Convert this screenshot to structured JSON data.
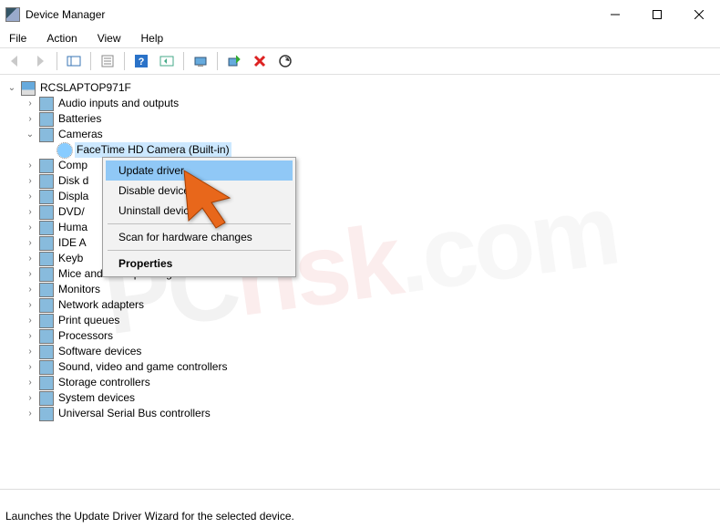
{
  "title": "Device Manager",
  "menu": {
    "file": "File",
    "action": "Action",
    "view": "View",
    "help": "Help"
  },
  "tree": {
    "root": "RCSLAPTOP971F",
    "items": [
      {
        "label": "Audio inputs and outputs",
        "exp": false
      },
      {
        "label": "Batteries",
        "exp": false
      },
      {
        "label": "Cameras",
        "exp": true,
        "child": "FaceTime HD Camera (Built-in)"
      },
      {
        "label": "Comp",
        "exp": false
      },
      {
        "label": "Disk d",
        "exp": false
      },
      {
        "label": "Displa",
        "exp": false
      },
      {
        "label": "DVD/",
        "exp": false
      },
      {
        "label": "Huma",
        "exp": false
      },
      {
        "label": "IDE A",
        "exp": false
      },
      {
        "label": "Keyb",
        "exp": false
      },
      {
        "label": "Mice and other pointing devices",
        "exp": false
      },
      {
        "label": "Monitors",
        "exp": false
      },
      {
        "label": "Network adapters",
        "exp": false
      },
      {
        "label": "Print queues",
        "exp": false
      },
      {
        "label": "Processors",
        "exp": false
      },
      {
        "label": "Software devices",
        "exp": false
      },
      {
        "label": "Sound, video and game controllers",
        "exp": false
      },
      {
        "label": "Storage controllers",
        "exp": false
      },
      {
        "label": "System devices",
        "exp": false
      },
      {
        "label": "Universal Serial Bus controllers",
        "exp": false
      }
    ]
  },
  "ctx": {
    "update": "Update driver",
    "disable": "Disable device",
    "uninstall": "Uninstall device",
    "scan": "Scan for hardware changes",
    "properties": "Properties"
  },
  "status": "Launches the Update Driver Wizard for the selected device.",
  "watermark": {
    "p1": "PC",
    "p2": "risk",
    "p3": ".com"
  }
}
